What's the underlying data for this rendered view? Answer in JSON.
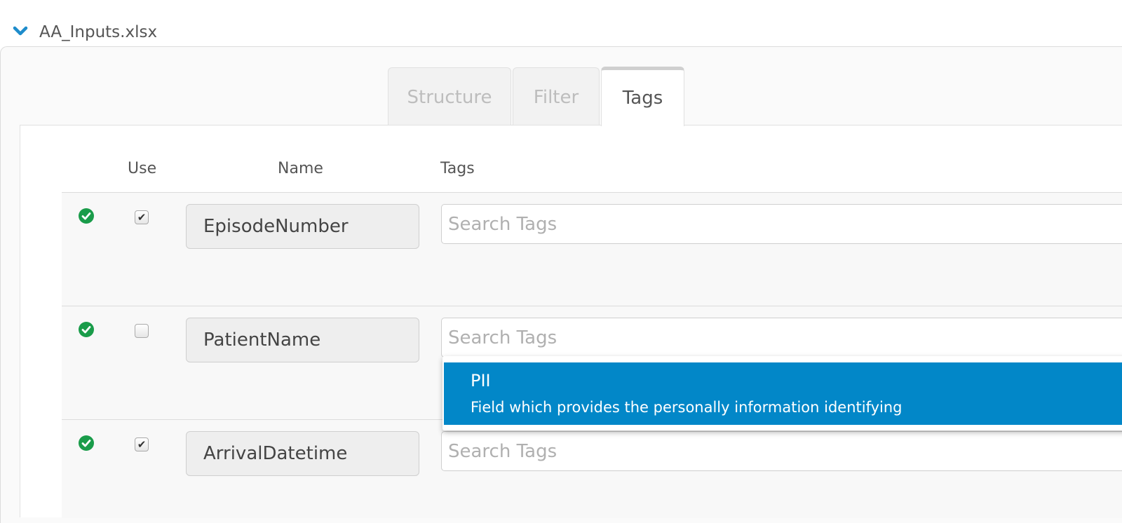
{
  "file": {
    "name": "AA_Inputs.xlsx",
    "icon": "chevron-down-icon"
  },
  "tabs": [
    {
      "label": "Structure",
      "active": false
    },
    {
      "label": "Filter",
      "active": false
    },
    {
      "label": "Tags",
      "active": true
    }
  ],
  "columns": {
    "use": "Use",
    "name": "Name",
    "tags": "Tags"
  },
  "rows": [
    {
      "status": "ok",
      "use": true,
      "name": "EpisodeNumber",
      "tags_placeholder": "Search Tags"
    },
    {
      "status": "ok",
      "use": false,
      "name": "PatientName",
      "tags_placeholder": "Search Tags"
    },
    {
      "status": "ok",
      "use": true,
      "name": "ArrivalDatetime",
      "tags_placeholder": "Search Tags"
    }
  ],
  "dropdown": {
    "title": "PII",
    "description": "Field which provides the personally information identifying"
  },
  "colors": {
    "accent": "#0287c8",
    "ok": "#1a9c4a",
    "chevron": "#1e8ccb"
  }
}
